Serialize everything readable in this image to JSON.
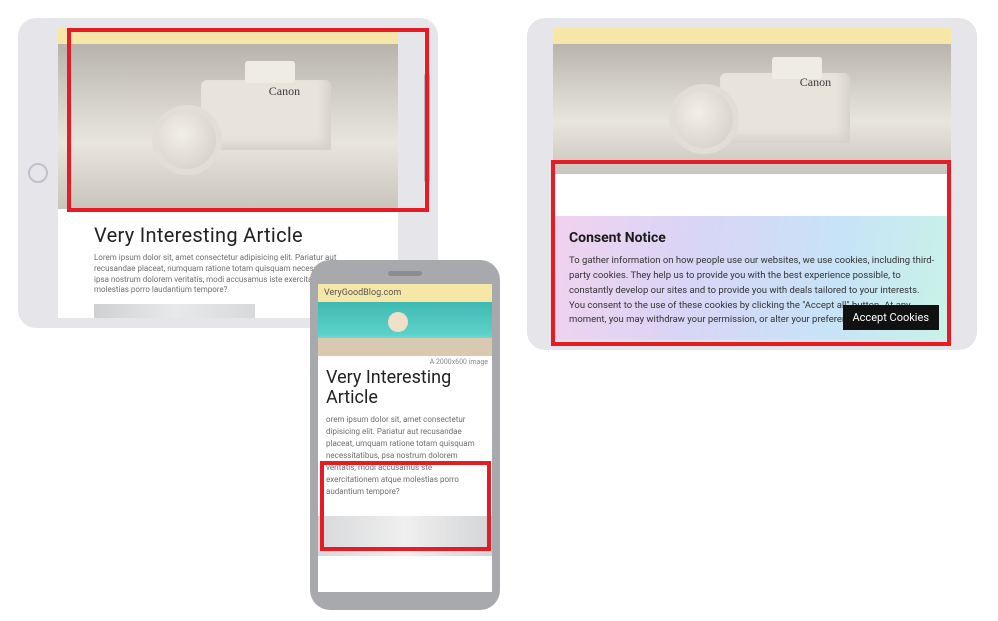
{
  "tablet_left": {
    "camera_brand": "Canon",
    "article_title": "Very Interesting Article",
    "article_text": "Lorem ipsum dolor sit, amet consectetur adipisicing elit. Pariatur aut recusandae placeat, numquam ratione totam quisquam necessitatibus, ipsa nostrum dolorem veritatis, modi accusamus iste exercitationem atque molestias porro laudantium tempore?"
  },
  "phone": {
    "url": "VeryGoodBlog.com",
    "image_caption": "A 2000x600 image",
    "article_title": "Very Interesting Article",
    "article_text": "orem ipsum dolor sit, amet consectetur dipisicing elit. Pariatur aut recusandae placeat, umquam ratione totam quisquam necessitatibus, psa nostrum dolorem veritatis, modi accusamus ste exercitationem atque molestias porro audantium tempore?"
  },
  "tablet_right": {
    "camera_brand": "Canon",
    "consent_title": "Consent Notice",
    "consent_text": "To gather information on how people use our websites, we use cookies, including third-party cookies. They help us to provide you with the best experience possible, to constantly develop our sites and to provide you with deals tailored to your interests. You consent to the use of these cookies by clicking the \"Accept all\" button. At any moment, you may withdraw your permission, or alter your preferences.",
    "accept_label": "Accept Cookies"
  }
}
